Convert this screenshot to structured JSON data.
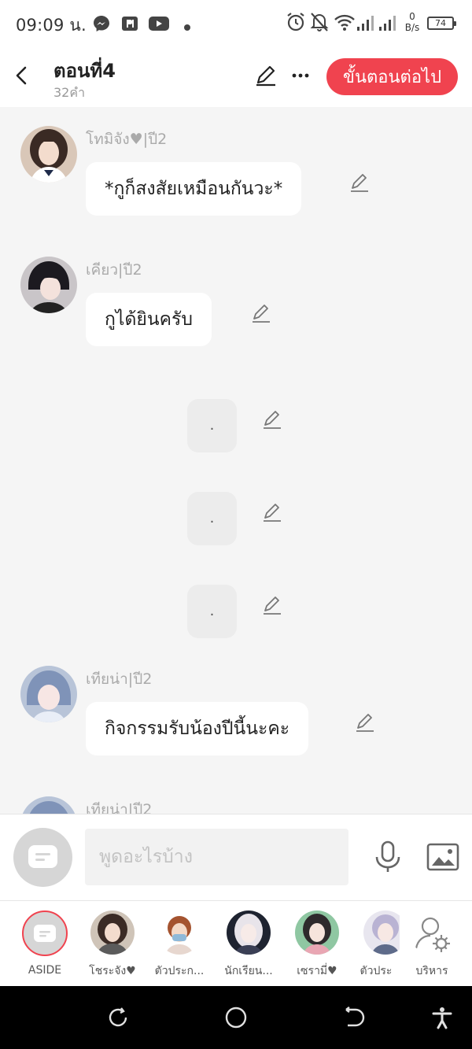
{
  "status_bar": {
    "time": "09:09 น.",
    "net_speed_value": "0",
    "net_speed_unit": "B/s",
    "battery": "74"
  },
  "header": {
    "title": "ตอนที่4",
    "word_count": "32คำ",
    "next_button": "ขั้นตอนต่อไป"
  },
  "messages": [
    {
      "name": "โทมิจัง♥|ปี2",
      "text": "*กูก็สงสัยเหมือนกันวะ*"
    },
    {
      "name": "เคียว|ปี2",
      "text": "กูได้ยินครับ"
    },
    {
      "text": "."
    },
    {
      "text": "."
    },
    {
      "text": "."
    },
    {
      "name": "เทียน่า|ปี2",
      "text": "กิจกรรมรับน้องปีนี้นะคะ"
    },
    {
      "name": "เทียน่า|ปี2"
    }
  ],
  "composer": {
    "placeholder": "พูดอะไรบ้าง"
  },
  "characters": [
    {
      "label": "ASIDE"
    },
    {
      "label": "โชระจัง♥"
    },
    {
      "label": "ตัวประก..."
    },
    {
      "label": "นักเรียน..."
    },
    {
      "label": "เซรามี่♥"
    },
    {
      "label": "ตัวประ"
    },
    {
      "label": "บริหาร"
    }
  ],
  "colors": {
    "accent": "#f0434f",
    "chat_background": "#f5f5f5",
    "bubble": "#ffffff",
    "narration_bubble": "#ececec"
  }
}
